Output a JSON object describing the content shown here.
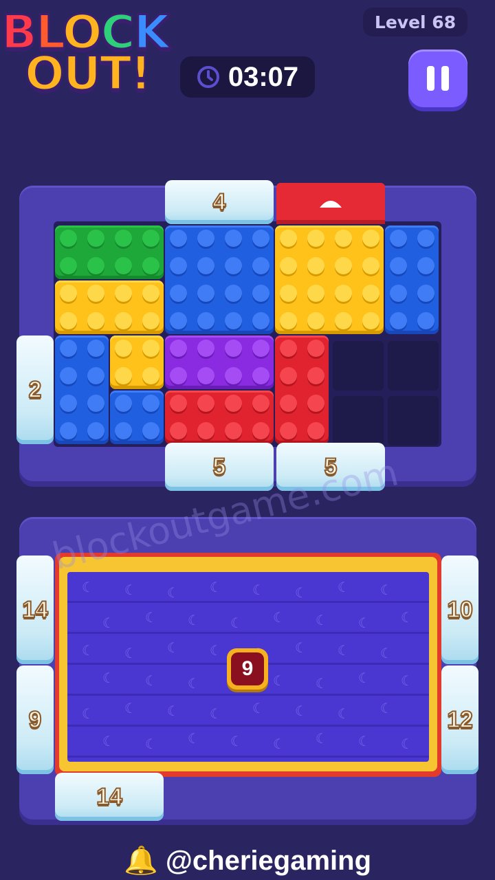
{
  "logo": {
    "line1": [
      "B",
      "L",
      "O",
      "C",
      "K"
    ],
    "line2": "OUT!"
  },
  "header": {
    "level_label": "Level 68",
    "timer": "03:07"
  },
  "colors": {
    "green": "#1fa83a",
    "blue": "#1f5fe0",
    "yellow": "#ffc21a",
    "purple": "#8a2be2",
    "red": "#e0232e",
    "board": "#4c3fb0"
  },
  "gates": {
    "top_left": "4",
    "left": "2",
    "bottom_mid": "5",
    "bottom_right": "5",
    "tray_left_top": "14",
    "tray_left_bottom": "9",
    "tray_right_top": "10",
    "tray_right_bottom": "12",
    "tray_bottom": "14"
  },
  "tray": {
    "badge": "9"
  },
  "watermark": "blockoutgame.com",
  "footer": {
    "handle": "@cheriegaming"
  }
}
